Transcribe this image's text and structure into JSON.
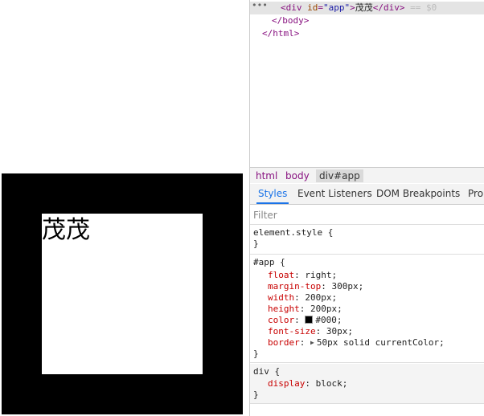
{
  "page": {
    "app_text": "茂茂"
  },
  "dom_tree": {
    "selected_line": {
      "open_tag": "<div",
      "attr_name": "id",
      "attr_eq": "=",
      "attr_value": "\"app\"",
      "close_open": ">",
      "text": "茂茂",
      "close_tag": "</div>",
      "hint": "== $0"
    },
    "body_close": "</body>",
    "html_close": "</html>"
  },
  "breadcrumbs": [
    "html",
    "body",
    "div#app"
  ],
  "tabs": [
    "Styles",
    "Event Listeners",
    "DOM Breakpoints",
    "Prop"
  ],
  "filter_placeholder": "Filter",
  "styles": {
    "element_style": {
      "selector": "element.style {",
      "close": "}"
    },
    "app_rule": {
      "selector": "#app {",
      "props": [
        {
          "name": "float",
          "value": "right;"
        },
        {
          "name": "margin-top",
          "value": "300px;"
        },
        {
          "name": "width",
          "value": "200px;"
        },
        {
          "name": "height",
          "value": "200px;"
        },
        {
          "name": "color",
          "value": "#000;"
        },
        {
          "name": "font-size",
          "value": "30px;"
        },
        {
          "name": "border",
          "value": "50px solid currentColor;"
        }
      ],
      "close": "}"
    },
    "div_rule": {
      "selector": "div {",
      "props": [
        {
          "name": "display",
          "value": "block;"
        }
      ],
      "close": "}"
    }
  },
  "colors": {
    "swatch": "#000000",
    "accent": "#1a73e8"
  }
}
